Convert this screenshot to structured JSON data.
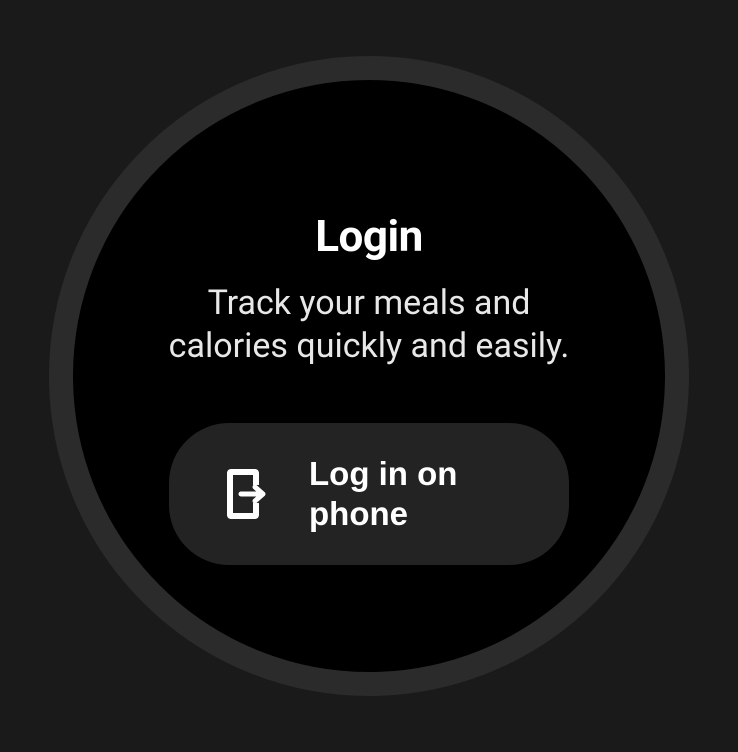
{
  "screen": {
    "title": "Login",
    "description": "Track your meals and calories quickly and easily."
  },
  "button": {
    "label": "Log in on\nphone",
    "icon": "phone-login-icon"
  },
  "colors": {
    "background": "#1a1a1a",
    "watchFace": "#000000",
    "bezel": "#2b2b2b",
    "buttonBg": "#232323",
    "text": "#ffffff"
  }
}
